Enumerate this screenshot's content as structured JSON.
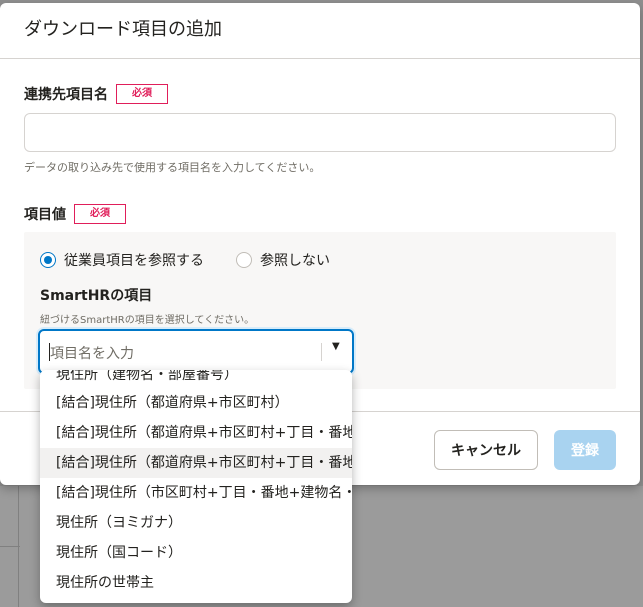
{
  "modal": {
    "title": "ダウンロード項目の追加",
    "required_label": "必須",
    "field1": {
      "label": "連携先項目名",
      "value": "",
      "help": "データの取り込み先で使用する項目名を入力してください。"
    },
    "field2": {
      "label": "項目値",
      "radio_options": [
        "従業員項目を参照する",
        "参照しない"
      ],
      "selected_option": "従業員項目を参照する",
      "sub_label": "SmartHRの項目",
      "sub_help": "紐づけるSmartHRの項目を選択してください。",
      "combo_placeholder": "項目名を入力"
    },
    "footer": {
      "cancel_label": "キャンセル",
      "submit_label": "登録"
    }
  },
  "dropdown": {
    "items": [
      "現住所（建物名・部屋番号）",
      "[結合]現住所（都道府県+市区町村）",
      "[結合]現住所（都道府県+市区町村+丁目・番地）",
      "[結合]現住所（都道府県+市区町村+丁目・番地+建物名・部屋番号）",
      "[結合]現住所（市区町村+丁目・番地+建物名・部屋番号）",
      "現住所（ヨミガナ）",
      "現住所（国コード）",
      "現住所の世帯主"
    ],
    "highlighted_index": 3
  },
  "colors": {
    "accent": "#0077c7",
    "required": "#e01e5a",
    "submit_disabled": "#a9d3f0"
  }
}
